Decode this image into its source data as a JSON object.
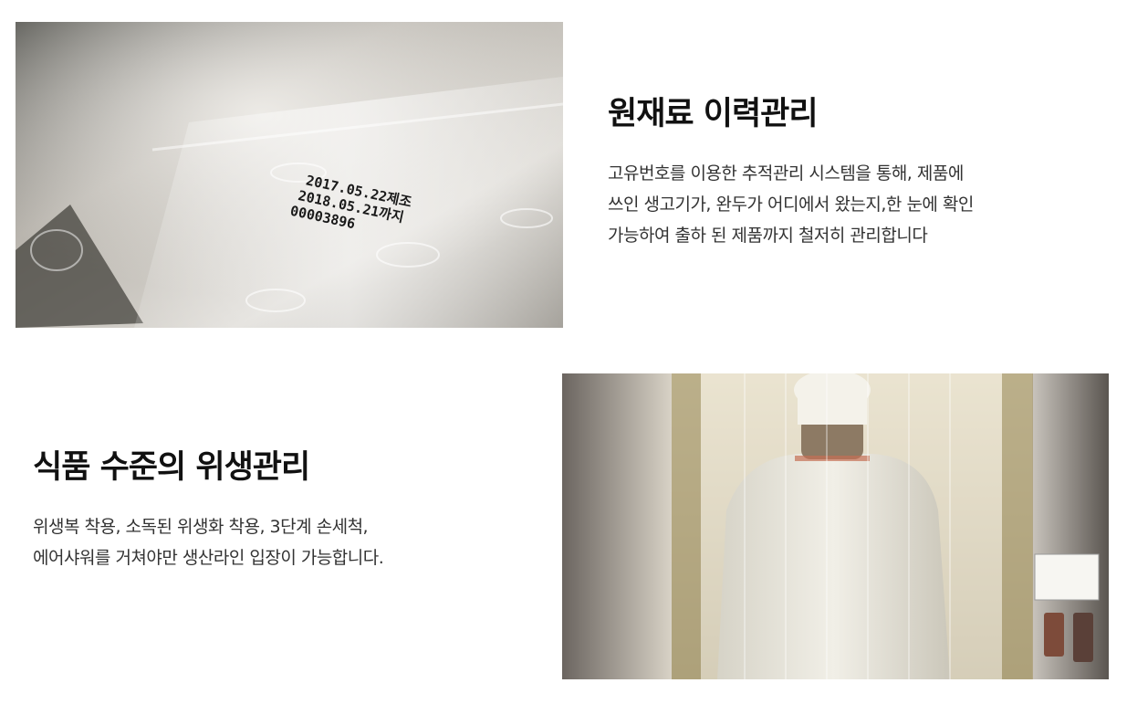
{
  "sections": [
    {
      "id": "traceability",
      "title": "원재료 이력관리",
      "lines": [
        "고유번호를 이용한 추적관리 시스템을 통해, 제품에",
        "쓰인 생고기가, 완두가 어디에서 왔는지,한 눈에 확인",
        "가능하여 출하 된 제품까지 철저히 관리합니다"
      ],
      "image": {
        "icon": "packaging-label-photo",
        "printed_text": [
          "2017.05.22제조",
          "2018.05.21까지",
          "00003896"
        ]
      }
    },
    {
      "id": "hygiene",
      "title": "식품 수준의 위생관리",
      "lines": [
        "위생복 착용, 소독된 위생화 착용, 3단계 손세척,",
        "에어샤워를 거쳐야만 생산라인 입장이 가능합니다."
      ],
      "image": {
        "icon": "hygiene-worker-photo"
      }
    }
  ],
  "colors": {
    "heading": "#111111",
    "body_text": "#333333",
    "background": "#ffffff"
  }
}
